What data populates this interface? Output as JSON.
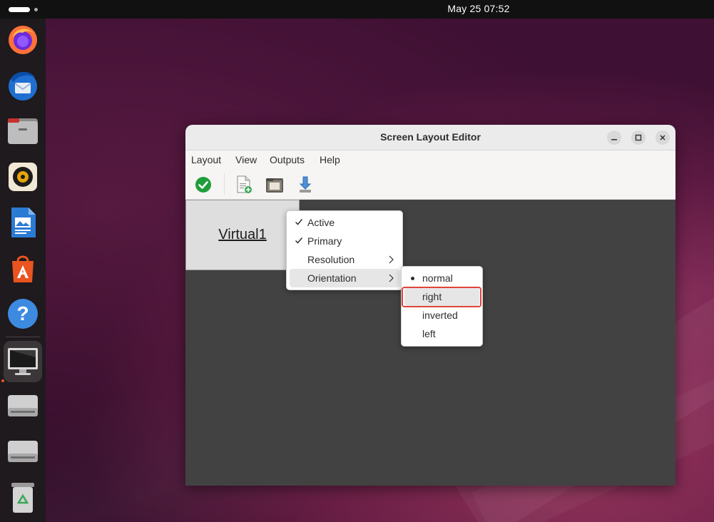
{
  "topbar": {
    "clock": "May 25  07:52"
  },
  "dock": {
    "items": [
      {
        "name": "firefox-icon"
      },
      {
        "name": "thunderbird-icon"
      },
      {
        "name": "files-icon"
      },
      {
        "name": "rhythmbox-icon"
      },
      {
        "name": "writer-icon"
      },
      {
        "name": "app-center-icon"
      },
      {
        "name": "help-icon"
      },
      {
        "name": "display-settings-icon"
      },
      {
        "name": "drive-icon"
      },
      {
        "name": "drive-icon"
      },
      {
        "name": "trash-icon"
      }
    ]
  },
  "window": {
    "title": "Screen Layout Editor",
    "menubar": [
      "Layout",
      "View",
      "Outputs",
      "Help"
    ],
    "toolbar": [
      "apply-icon",
      "new-layout-icon",
      "open-layout-icon",
      "save-layout-icon"
    ]
  },
  "canvas": {
    "output_label": "Virtual1"
  },
  "context_menu": {
    "items": [
      {
        "label": "Active",
        "checked": true
      },
      {
        "label": "Primary",
        "checked": true
      },
      {
        "label": "Resolution",
        "submenu": true
      },
      {
        "label": "Orientation",
        "submenu": true,
        "highlighted": true
      }
    ]
  },
  "orientation_menu": {
    "items": [
      {
        "label": "normal",
        "selected": true
      },
      {
        "label": "right",
        "highlighted": true
      },
      {
        "label": "inverted"
      },
      {
        "label": "left"
      }
    ]
  },
  "colors": {
    "highlight_border": "#e0453a",
    "apply_green": "#1f9d3a"
  }
}
